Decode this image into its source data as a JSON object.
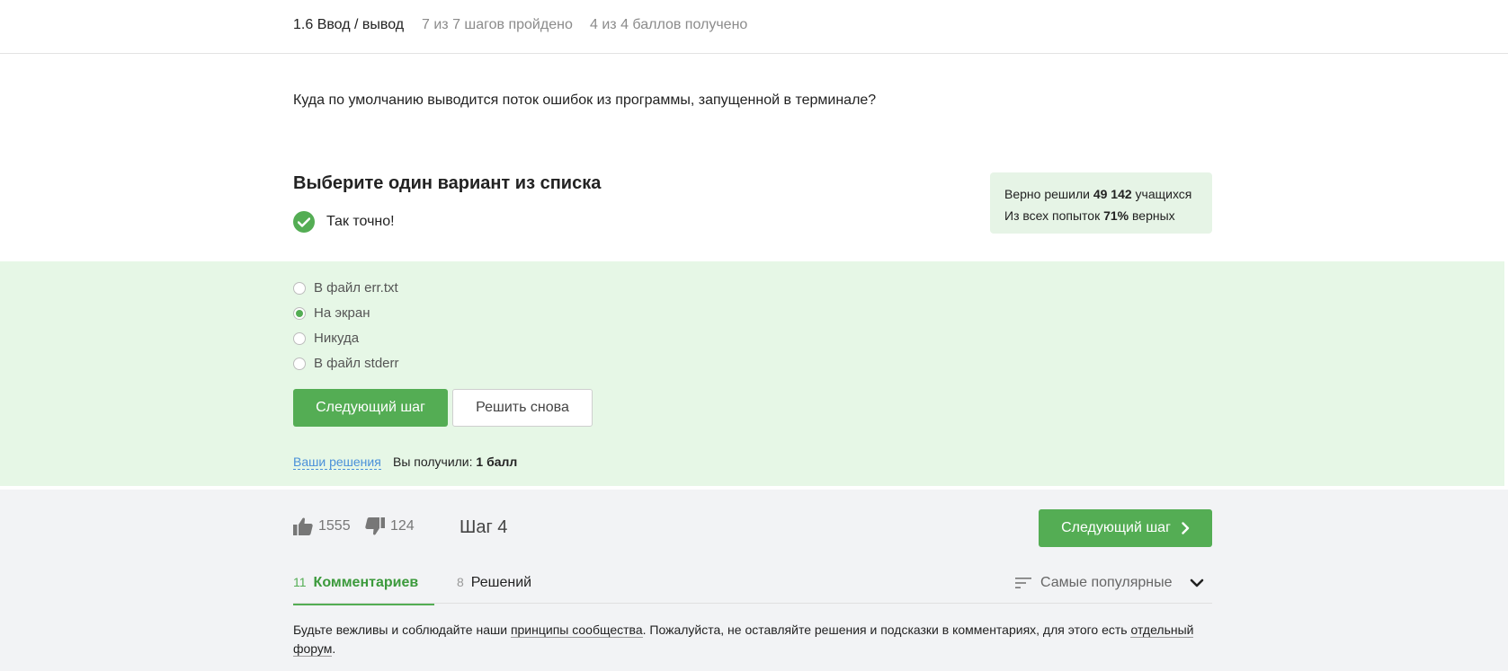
{
  "header": {
    "title": "1.6 Ввод / вывод",
    "progress": "7 из 7 шагов пройдено",
    "score": "4 из 4 баллов  получено"
  },
  "question": "Куда по умолчанию выводится поток ошибок из программы, запущенной в терминале?",
  "instruction": "Выберите один вариант из списка",
  "result": {
    "label": "Так точно!",
    "icon": "check-circle-icon"
  },
  "stats": {
    "line1_prefix": "Верно решили ",
    "solved_count": "49 142",
    "line1_suffix": " учащихся",
    "line2_prefix": "Из всех попыток ",
    "correct_pct": "71%",
    "line2_suffix": " верных"
  },
  "options": [
    {
      "label": "В файл err.txt",
      "selected": false
    },
    {
      "label": "На экран",
      "selected": true
    },
    {
      "label": "Никуда",
      "selected": false
    },
    {
      "label": "В файл stderr",
      "selected": false
    }
  ],
  "buttons": {
    "next": "Следующий шаг",
    "retry": "Решить снова"
  },
  "solutions_link": "Ваши решения",
  "got": {
    "prefix": "Вы получили: ",
    "value": "1 балл"
  },
  "footer": {
    "likes": "1555",
    "dislikes": "124",
    "step": "Шаг 4",
    "next_step": "Следующий шаг"
  },
  "tabs": {
    "comments": {
      "count": "11",
      "label": "Комментариев"
    },
    "solutions": {
      "count": "8",
      "label": "Решений"
    }
  },
  "sort": {
    "label": "Самые популярные"
  },
  "notice": {
    "part1": "Будьте вежливы и соблюдайте наши ",
    "link1": "принципы сообщества",
    "part2": ". Пожалуйста, не оставляйте решения и подсказки в комментариях, для этого есть ",
    "link2": "отдельный форум",
    "part3": "."
  },
  "colors": {
    "accent": "#54ad54",
    "answers_bg": "#e6f7e6",
    "footer_bg": "#f2f3f5",
    "link": "#4a90d9"
  }
}
